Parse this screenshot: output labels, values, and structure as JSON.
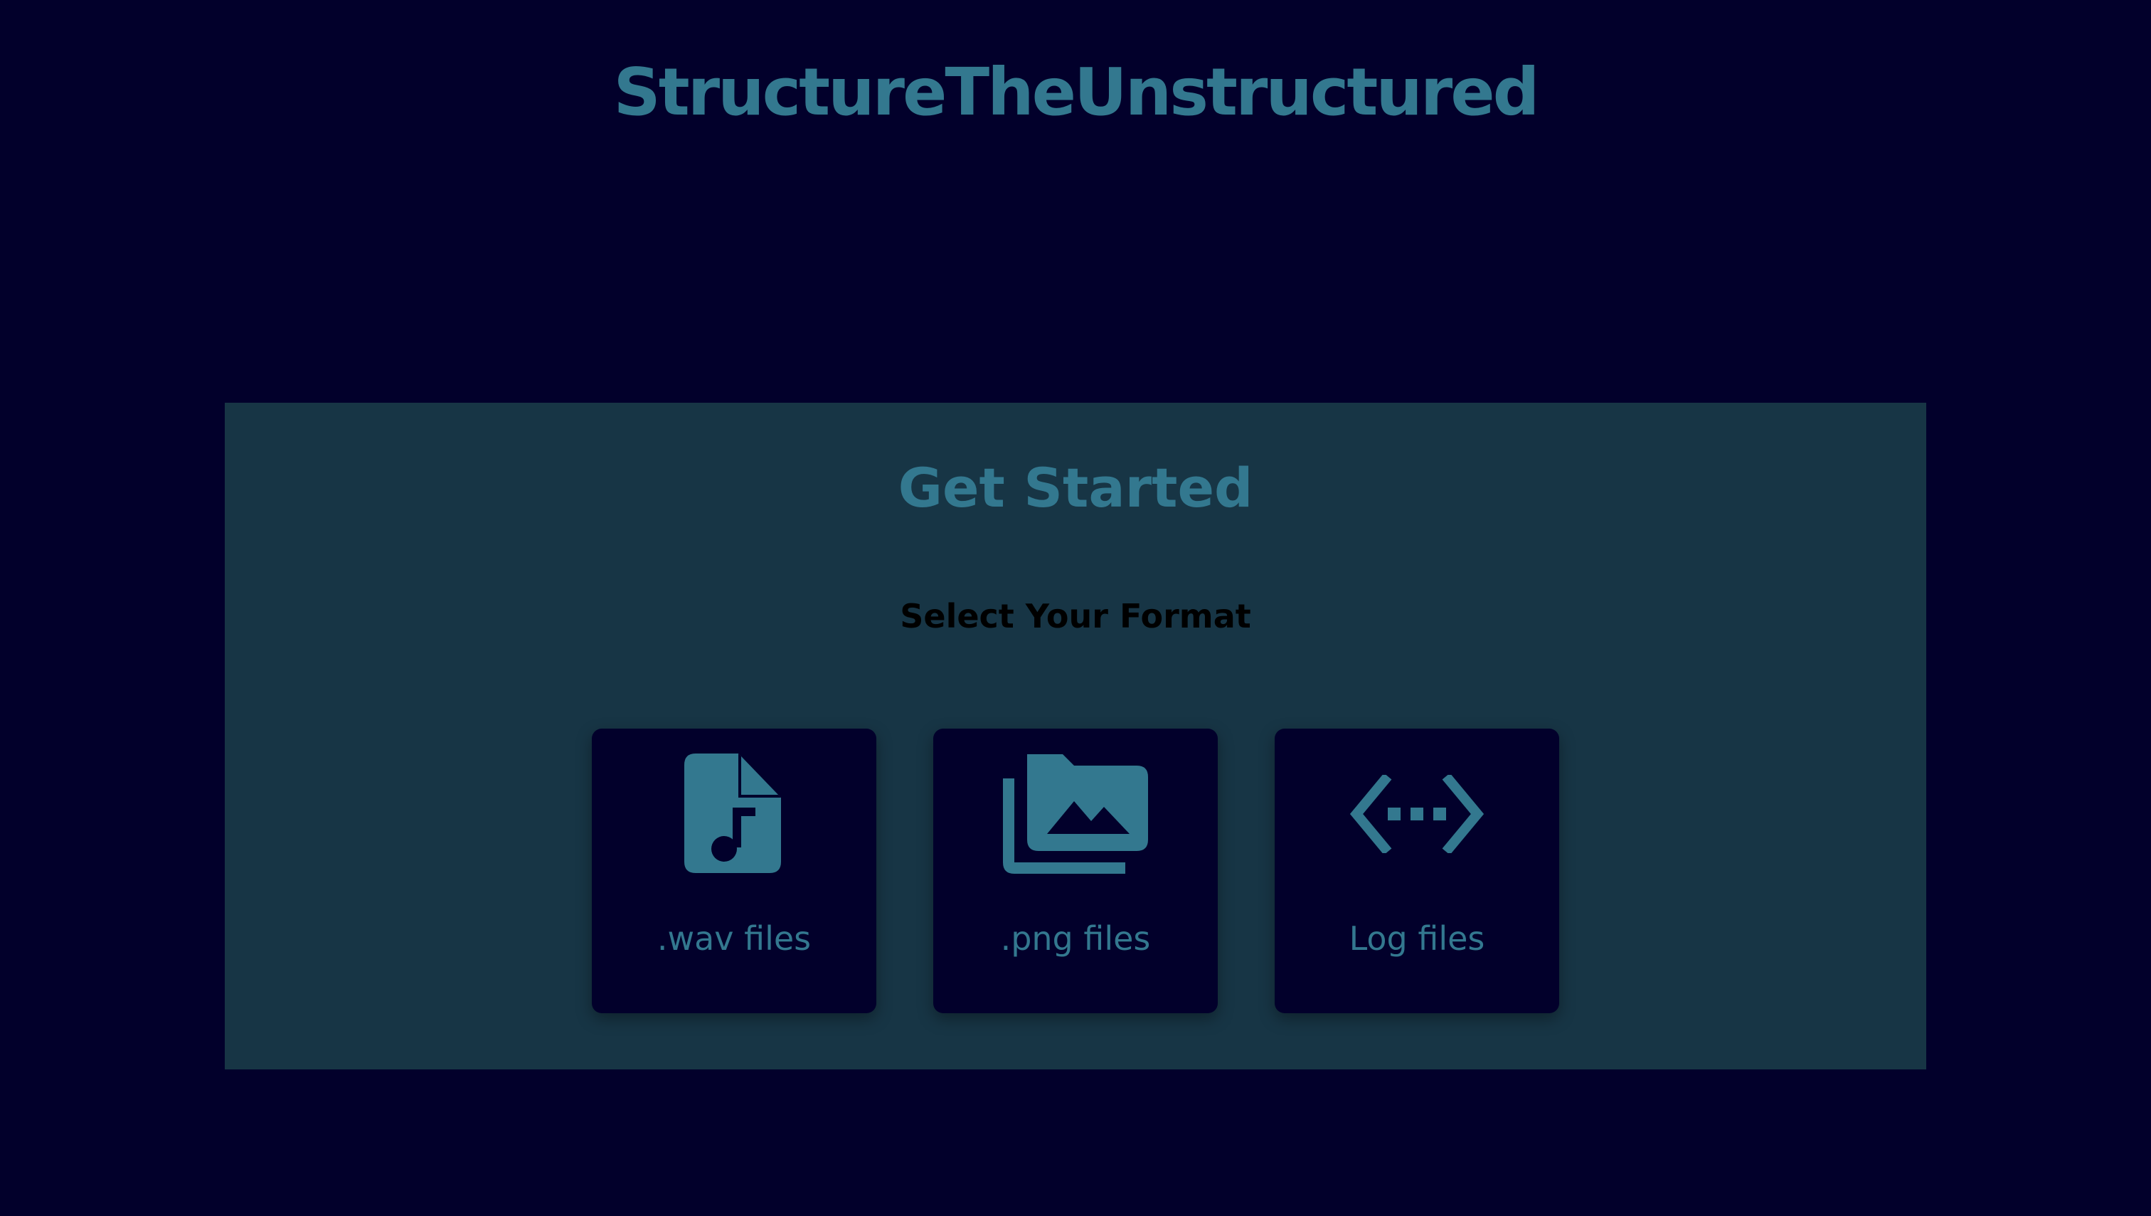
{
  "app": {
    "title": "StructureTheUnstructured"
  },
  "panel": {
    "title": "Get Started",
    "subtitle": "Select Your Format"
  },
  "formats": [
    {
      "label": ".wav files",
      "icon": "audio-file-icon"
    },
    {
      "label": ".png files",
      "icon": "photo-library-icon"
    },
    {
      "label": "Log files",
      "icon": "settings-ethernet-icon"
    }
  ],
  "colors": {
    "background": "#02002b",
    "panel": "#173545",
    "accent": "#33788f",
    "card": "#02002b"
  }
}
